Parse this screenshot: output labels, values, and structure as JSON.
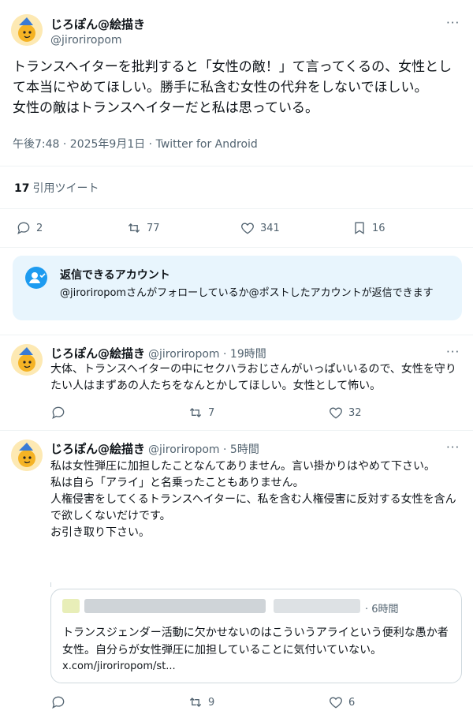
{
  "main_tweet": {
    "author_name": "じろぽん@絵描き",
    "author_handle": "@jiroriropom",
    "more_label": "···",
    "text": "トランスヘイターを批判すると「女性の敵！」て言ってくるの、女性として本当にやめてほしい。勝手に私含む女性の代弁をしないでほしい。\n女性の敵はトランスヘイターだと私は思っている。",
    "meta": "午後7:48 · 2025年9月1日 · Twitter for Android",
    "quote_count": "17",
    "quote_label": "引用ツイート",
    "actions": {
      "replies": "2",
      "retweets": "77",
      "likes": "341",
      "bookmarks": "16"
    }
  },
  "reply_restriction": {
    "title": "返信できるアカウント",
    "text": "@jiroriropomさんがフォローしているか@ポストしたアカウントが返信できます"
  },
  "replies": [
    {
      "author_name": "じろぽん@絵描き",
      "author_handle": "@jiroriropom · 19時間",
      "text": "大体、トランスヘイターの中にセクハラおじさんがいっぱいいるので、女性を守りたい人はまずあの人たちをなんとかしてほしい。女性として怖い。",
      "actions": {
        "replies": "",
        "retweets": "7",
        "likes": "32"
      }
    },
    {
      "author_name": "じろぽん@絵描き",
      "author_handle": "@jiroriropom · 5時間",
      "text": "私は女性弾圧に加担したことなんてありません。言い掛かりはやめて下さい。\n私は自ら「アライ」と名乗ったこともありません。\n人権侵害をしてくるトランスヘイターに、私を含む人権侵害に反対する女性を含んで欲しくないだけです。\nお引き取り下さい。",
      "actions": {
        "replies": "",
        "retweets": "9",
        "likes": "6"
      },
      "quote": {
        "time": "· 6時間",
        "text": "トランスジェンダー活動に欠かせないのはこういうアライという便利な愚か者女性。自分らが女性弾圧に加担していることに気付いていない。",
        "link": "x.com/jiroriropom/st..."
      }
    }
  ],
  "colors": {
    "text_primary": "#0f1419",
    "text_secondary": "#536471",
    "accent": "#1d9bf0",
    "notice_bg": "#e8f5fd"
  }
}
